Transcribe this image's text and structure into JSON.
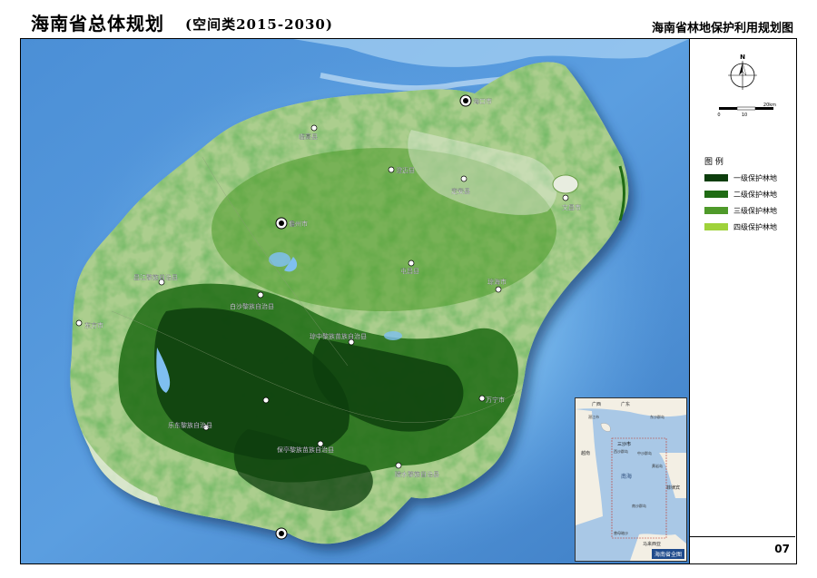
{
  "header": {
    "title": "海南省总体规划",
    "subtitle": "(空间类2015-2030)",
    "map_title": "海南省林地保护利用规划图"
  },
  "compass": {
    "north_label": "N"
  },
  "scale_bar": {
    "ticks": [
      "0",
      "10",
      "20km"
    ]
  },
  "legend": {
    "title": "图 例",
    "items": [
      {
        "label": "一级保护林地",
        "color": "#0d3d0d"
      },
      {
        "label": "二级保护林地",
        "color": "#1f6b14"
      },
      {
        "label": "三级保护林地",
        "color": "#4f9a2a"
      },
      {
        "label": "四级保护林地",
        "color": "#9fd23a"
      }
    ]
  },
  "page_number": "07",
  "cities": [
    {
      "name": "海口市"
    },
    {
      "name": "临高县"
    },
    {
      "name": "澄迈县"
    },
    {
      "name": "定安县"
    },
    {
      "name": "文昌市"
    },
    {
      "name": "儋州市"
    },
    {
      "name": "屯昌县"
    },
    {
      "name": "琼海市"
    },
    {
      "name": "昌江黎族自治县"
    },
    {
      "name": "白沙黎族自治县"
    },
    {
      "name": "东方市"
    },
    {
      "name": "琼中黎族苗族自治县"
    },
    {
      "name": "万宁市"
    },
    {
      "name": "乐东黎族自治县"
    },
    {
      "name": "保亭黎族苗族自治县"
    },
    {
      "name": "陵水黎族自治县"
    },
    {
      "name": "三亚市"
    },
    {
      "name": "五指山市"
    }
  ],
  "inset": {
    "labels": [
      "广西",
      "广东",
      "湛江市",
      "东沙群岛",
      "越南",
      "三沙市",
      "西沙群岛",
      "中沙群岛",
      "南海",
      "黄岩岛",
      "菲律宾",
      "南沙群岛",
      "马来西亚",
      "曾母暗沙"
    ],
    "caption": "海南省全图"
  }
}
